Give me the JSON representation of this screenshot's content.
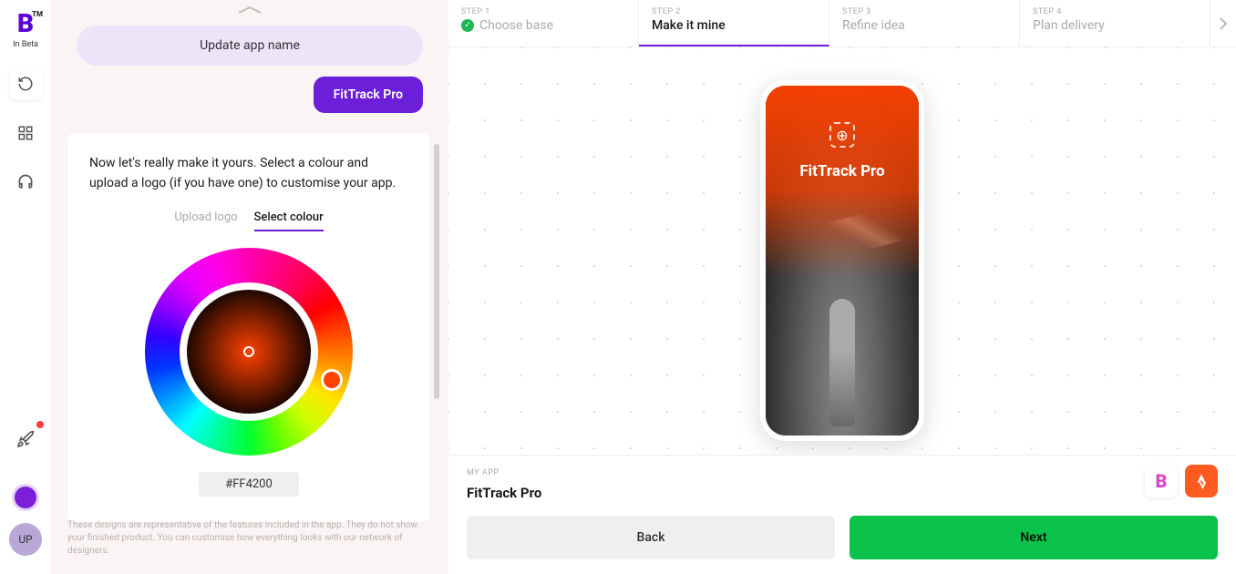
{
  "sidebar": {
    "logo_text": "B",
    "logo_tm": "TM",
    "beta_label": "In Beta",
    "avatar_initials": "UP"
  },
  "chat": {
    "update_name_label": "Update app name",
    "app_name_chip": "FitTrack Pro",
    "intro_text": "Now let's really make it yours. Select a colour and upload a logo (if you have one) to customise your app.",
    "tabs": {
      "upload": "Upload logo",
      "select": "Select colour"
    },
    "hex_value": "#FF4200",
    "colors": {
      "selected": "#FF4200"
    }
  },
  "disclaimer": "These designs are representative of the features included in the app. They do not show your finished product. You can customise how everything looks with our network of designers.",
  "stepper": {
    "steps": [
      {
        "num": "STEP 1",
        "label": "Choose base",
        "state": "done"
      },
      {
        "num": "STEP 2",
        "label": "Make it mine",
        "state": "active"
      },
      {
        "num": "STEP 3",
        "label": "Refine idea",
        "state": "pending"
      },
      {
        "num": "STEP 4",
        "label": "Plan delivery",
        "state": "pending"
      }
    ]
  },
  "phone": {
    "title": "FitTrack Pro"
  },
  "bottom": {
    "myapp_label": "MY APP",
    "app_title": "FitTrack Pro",
    "back_label": "Back",
    "next_label": "Next"
  }
}
